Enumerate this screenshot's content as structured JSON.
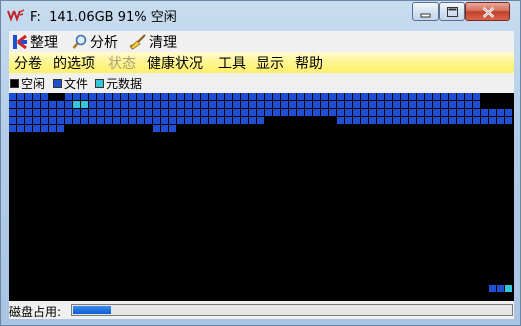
{
  "window": {
    "title": "F:  141.06GB 91% 空闲",
    "minimize_icon": "minimize-icon",
    "maximize_icon": "maximize-icon",
    "close_icon": "close-icon"
  },
  "toolbar": {
    "items": [
      {
        "label": "整理",
        "icon": "defragment-icon"
      },
      {
        "label": "分析",
        "icon": "magnifier-icon"
      },
      {
        "label": "清理",
        "icon": "broom-icon"
      }
    ]
  },
  "menu": {
    "items": [
      {
        "label": "分卷",
        "enabled": true
      },
      {
        "label": "的选项",
        "enabled": true
      },
      {
        "label": "状态",
        "enabled": false
      },
      {
        "label": "健康状况",
        "enabled": true
      },
      {
        "label": "工具",
        "enabled": true
      },
      {
        "label": "显示",
        "enabled": true
      },
      {
        "label": "帮助",
        "enabled": true
      }
    ]
  },
  "legend": {
    "items": [
      {
        "label": "空闲",
        "color": "#000000"
      },
      {
        "label": "文件",
        "color": "#1f4fd1"
      },
      {
        "label": "元数据",
        "color": "#35c6d8"
      }
    ]
  },
  "status": {
    "label": "磁盘占用:",
    "usage_fraction": 0.09
  },
  "colors": {
    "free": "#000000",
    "file": "#1f4fd1",
    "metadata": "#35c6d8",
    "gridline": "#000000"
  }
}
